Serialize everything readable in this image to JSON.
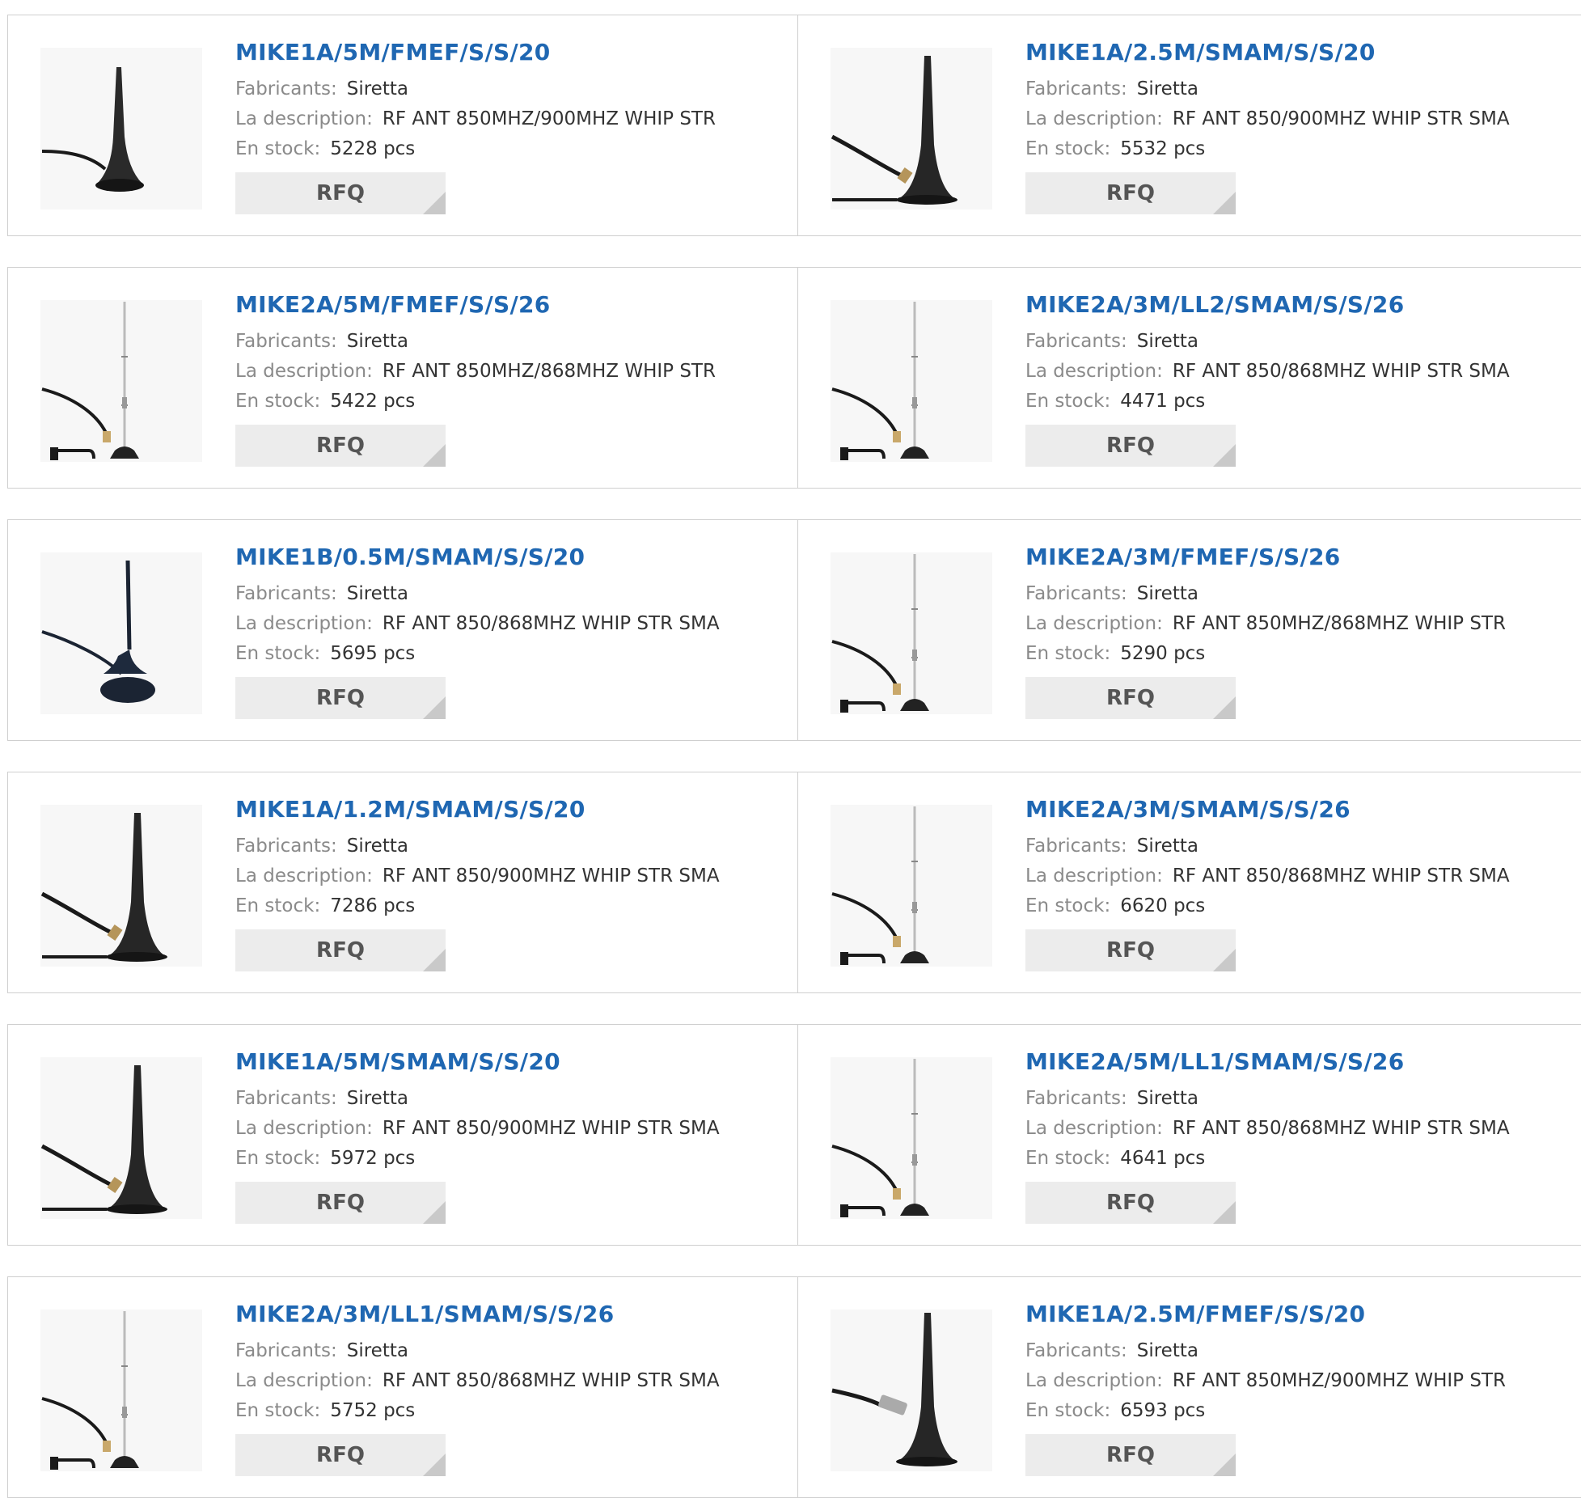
{
  "labels": {
    "manufacturer": "Fabricants:",
    "description": "La description:",
    "stock": "En stock:",
    "rfq": "RFQ"
  },
  "products": [
    {
      "part": "MIKE1A/5M/FMEF/S/S/20",
      "manufacturer": "Siretta",
      "description": "RF ANT 850MHZ/900MHZ WHIP STR",
      "stock": "5228 pcs",
      "image": "stubby-antenna-thin-icon"
    },
    {
      "part": "MIKE1A/2.5M/SMAM/S/S/20",
      "manufacturer": "Siretta",
      "description": "RF ANT 850/900MHZ WHIP STR SMA",
      "stock": "5532 pcs",
      "image": "stubby-antenna-icon"
    },
    {
      "part": "MIKE2A/5M/FMEF/S/S/26",
      "manufacturer": "Siretta",
      "description": "RF ANT 850MHZ/868MHZ WHIP STR",
      "stock": "5422 pcs",
      "image": "whip-antenna-icon"
    },
    {
      "part": "MIKE2A/3M/LL2/SMAM/S/S/26",
      "manufacturer": "Siretta",
      "description": "RF ANT 850/868MHZ WHIP STR SMA",
      "stock": "4471 pcs",
      "image": "whip-antenna-icon"
    },
    {
      "part": "MIKE1B/0.5M/SMAM/S/S/20",
      "manufacturer": "Siretta",
      "description": "RF ANT 850/868MHZ WHIP STR SMA",
      "stock": "5695 pcs",
      "image": "puck-antenna-icon"
    },
    {
      "part": "MIKE2A/3M/FMEF/S/S/26",
      "manufacturer": "Siretta",
      "description": "RF ANT 850MHZ/868MHZ WHIP STR",
      "stock": "5290 pcs",
      "image": "whip-antenna-icon"
    },
    {
      "part": "MIKE1A/1.2M/SMAM/S/S/20",
      "manufacturer": "Siretta",
      "description": "RF ANT 850/900MHZ WHIP STR SMA",
      "stock": "7286 pcs",
      "image": "stubby-antenna-icon"
    },
    {
      "part": "MIKE2A/3M/SMAM/S/S/26",
      "manufacturer": "Siretta",
      "description": "RF ANT 850/868MHZ WHIP STR SMA",
      "stock": "6620 pcs",
      "image": "whip-antenna-icon"
    },
    {
      "part": "MIKE1A/5M/SMAM/S/S/20",
      "manufacturer": "Siretta",
      "description": "RF ANT 850/900MHZ WHIP STR SMA",
      "stock": "5972 pcs",
      "image": "stubby-antenna-icon"
    },
    {
      "part": "MIKE2A/5M/LL1/SMAM/S/S/26",
      "manufacturer": "Siretta",
      "description": "RF ANT 850/868MHZ WHIP STR SMA",
      "stock": "4641 pcs",
      "image": "whip-antenna-icon"
    },
    {
      "part": "MIKE2A/3M/LL1/SMAM/S/S/26",
      "manufacturer": "Siretta",
      "description": "RF ANT 850/868MHZ WHIP STR SMA",
      "stock": "5752 pcs",
      "image": "whip-antenna-icon"
    },
    {
      "part": "MIKE1A/2.5M/FMEF/S/S/20",
      "manufacturer": "Siretta",
      "description": "RF ANT 850MHZ/900MHZ WHIP STR",
      "stock": "6593 pcs",
      "image": "stubby-antenna-fme-icon"
    }
  ]
}
